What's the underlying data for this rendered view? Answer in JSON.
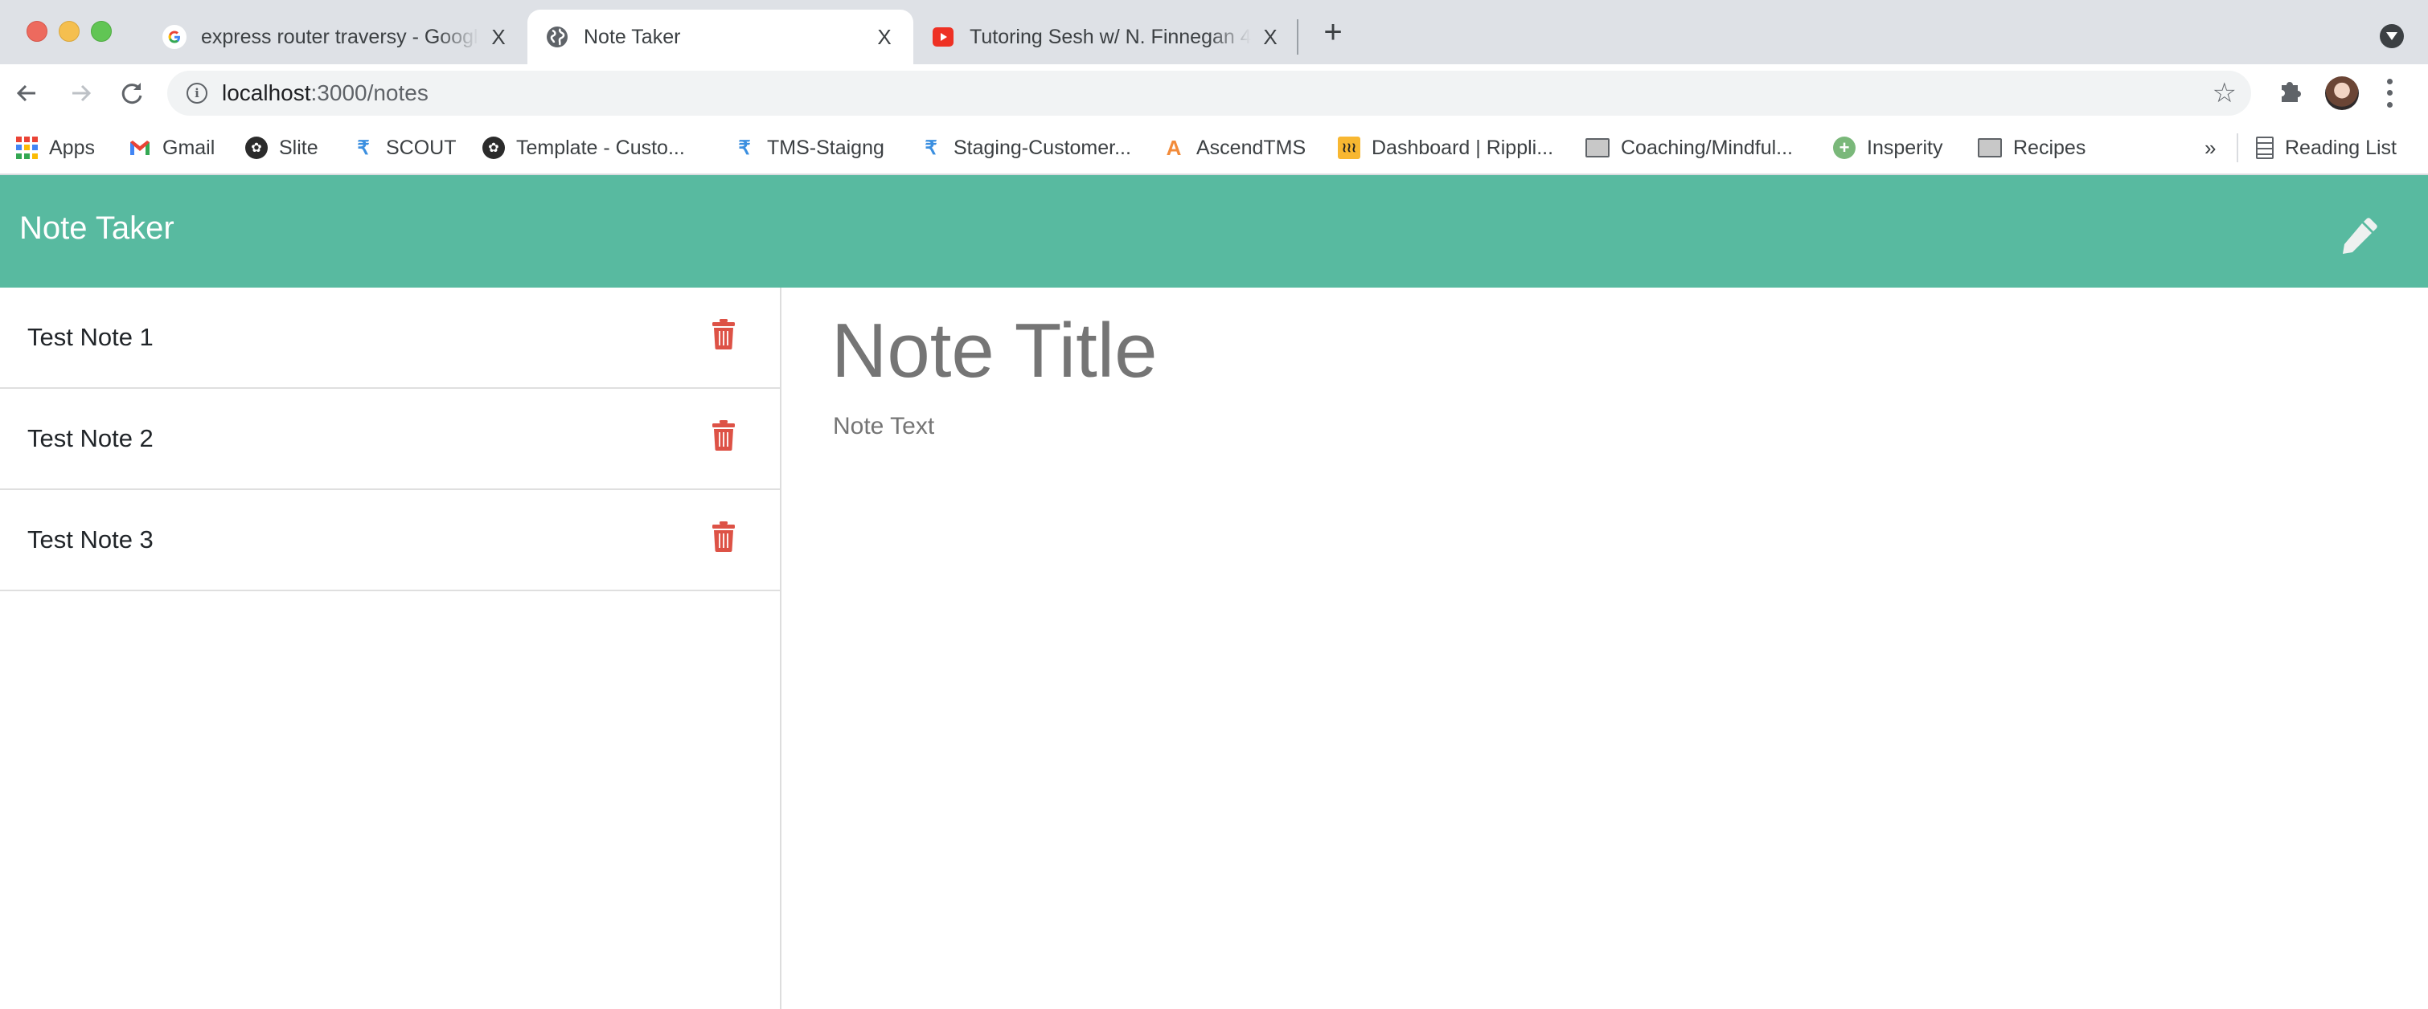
{
  "browser": {
    "tabs": [
      {
        "title": "express router traversy - Google Search",
        "favicon": "google-icon",
        "active": false
      },
      {
        "title": "Note Taker",
        "favicon": "globe-icon",
        "active": true
      },
      {
        "title": "Tutoring Sesh w/ N. Finnegan 4",
        "favicon": "youtube-icon",
        "active": false
      }
    ],
    "close_glyph": "X",
    "new_tab_glyph": "+",
    "url_host": "localhost",
    "url_rest": ":3000/notes",
    "bookmarks": [
      {
        "label": "Apps",
        "icon": "apps-grid-icon"
      },
      {
        "label": "Gmail",
        "icon": "gmail-icon"
      },
      {
        "label": "Slite",
        "icon": "slite-icon"
      },
      {
        "label": "SCOUT",
        "icon": "scout-icon"
      },
      {
        "label": "Template - Custo...",
        "icon": "slite-icon"
      },
      {
        "label": "TMS-Staigng",
        "icon": "scout-icon"
      },
      {
        "label": "Staging-Customer...",
        "icon": "scout-icon"
      },
      {
        "label": "AscendTMS",
        "icon": "ascendtms-icon"
      },
      {
        "label": "Dashboard | Rippli...",
        "icon": "rippling-icon"
      },
      {
        "label": "Coaching/Mindful...",
        "icon": "folder-icon"
      },
      {
        "label": "Insperity",
        "icon": "insperity-icon"
      },
      {
        "label": "Recipes",
        "icon": "folder-icon"
      }
    ],
    "overflow_glyph": "»",
    "reading_list": "Reading List"
  },
  "app": {
    "title": "Note Taker",
    "accent_color": "#58baa0",
    "delete_color": "#dd5246",
    "notes": [
      {
        "title": "Test Note 1"
      },
      {
        "title": "Test Note 2"
      },
      {
        "title": "Test Note 3"
      }
    ],
    "editor": {
      "title_placeholder": "Note Title",
      "text_placeholder": "Note Text"
    }
  }
}
